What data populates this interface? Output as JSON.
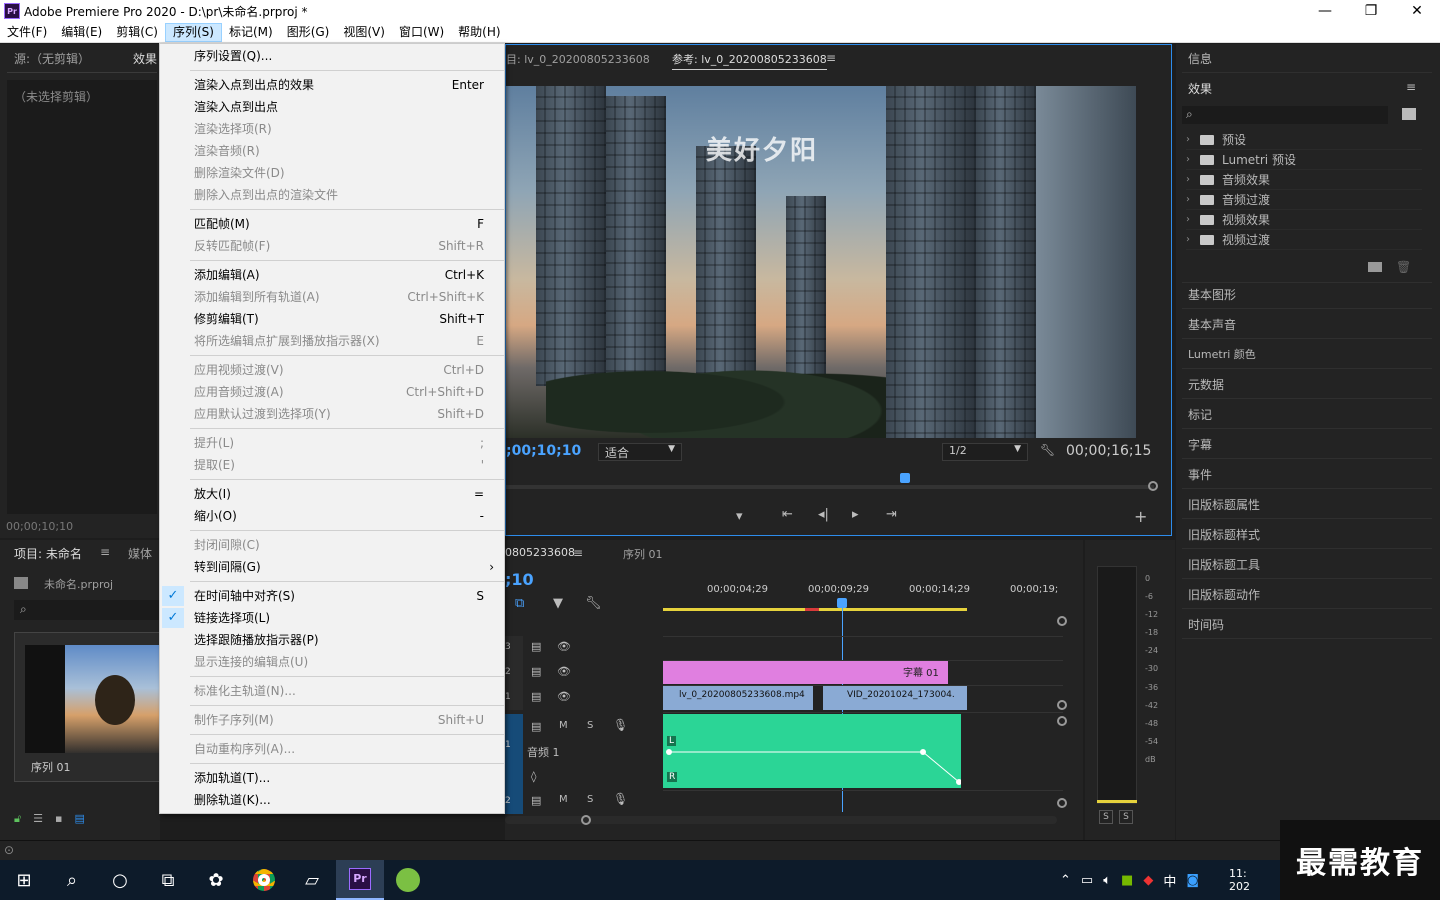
{
  "window": {
    "title": "Adobe Premiere Pro 2020 - D:\\pr\\未命名.prproj *",
    "app_icon": "Pr"
  },
  "menubar": [
    "文件(F)",
    "编辑(E)",
    "剪辑(C)",
    "序列(S)",
    "标记(M)",
    "图形(G)",
    "视图(V)",
    "窗口(W)",
    "帮助(H)"
  ],
  "source": {
    "tab_source": "源:（无剪辑）",
    "tab_effects": "效果",
    "no_clip": "（未选择剪辑）",
    "timecode": "00;00;10;10"
  },
  "project": {
    "tab_project": "项目: 未命名",
    "tab_media": "媒体",
    "file": "未命名.prproj",
    "thumb_label": "序列 01"
  },
  "program": {
    "tab_prev": "目: lv_0_20200805233608",
    "tab_ref": "参考: lv_0_20200805233608",
    "caption": "美好夕阳",
    "timecode_left": ";00;10;10",
    "fit": "适合",
    "resolution": "1/2",
    "timecode_right": "00;00;16;15"
  },
  "right_panel": {
    "info": "信息",
    "effects": "效果",
    "fx_items": [
      "预设",
      "Lumetri 预设",
      "音频效果",
      "音频过渡",
      "视频效果",
      "视频过渡"
    ],
    "sections": [
      "基本图形",
      "基本声音",
      "Lumetri 颜色",
      "元数据",
      "标记",
      "字幕",
      "事件",
      "旧版标题属性",
      "旧版标题样式",
      "旧版标题工具",
      "旧版标题动作",
      "时间码"
    ]
  },
  "timeline": {
    "tab_seq": "0805233608",
    "tab_seq2": "序列 01",
    "timecode": ";10",
    "ruler": [
      "00;00;04;29",
      "00;00;09;29",
      "00;00;14;29",
      "00;00;19;"
    ],
    "title_clip": "字幕 01",
    "clip1": "lv_0_20200805233608.mp4",
    "clip2": "VID_20201024_173004.",
    "audio_track": "音频 1",
    "track_labels": [
      "3",
      "2",
      "1",
      "1",
      "2"
    ],
    "btn_m": "M",
    "btn_s": "S",
    "ch_l": "L",
    "ch_r": "R"
  },
  "meter": {
    "scale": [
      "0",
      "-6",
      "-12",
      "-18",
      "-24",
      "-30",
      "-36",
      "-42",
      "-48",
      "-54",
      "dB"
    ],
    "solo": "S"
  },
  "sequence_menu": {
    "items": [
      {
        "label": "序列设置(Q)...",
        "shortcut": "",
        "disabled": false
      },
      {
        "label": "渲染入点到出点的效果",
        "shortcut": "Enter",
        "disabled": false
      },
      {
        "label": "渲染入点到出点",
        "shortcut": "",
        "disabled": false
      },
      {
        "label": "渲染选择项(R)",
        "shortcut": "",
        "disabled": true
      },
      {
        "label": "渲染音频(R)",
        "shortcut": "",
        "disabled": true
      },
      {
        "label": "删除渲染文件(D)",
        "shortcut": "",
        "disabled": true
      },
      {
        "label": "删除入点到出点的渲染文件",
        "shortcut": "",
        "disabled": true
      },
      {
        "label": "匹配帧(M)",
        "shortcut": "F",
        "disabled": false
      },
      {
        "label": "反转匹配帧(F)",
        "shortcut": "Shift+R",
        "disabled": true
      },
      {
        "label": "添加编辑(A)",
        "shortcut": "Ctrl+K",
        "disabled": false
      },
      {
        "label": "添加编辑到所有轨道(A)",
        "shortcut": "Ctrl+Shift+K",
        "disabled": true
      },
      {
        "label": "修剪编辑(T)",
        "shortcut": "Shift+T",
        "disabled": false
      },
      {
        "label": "将所选编辑点扩展到播放指示器(X)",
        "shortcut": "E",
        "disabled": true
      },
      {
        "label": "应用视频过渡(V)",
        "shortcut": "Ctrl+D",
        "disabled": true
      },
      {
        "label": "应用音频过渡(A)",
        "shortcut": "Ctrl+Shift+D",
        "disabled": true
      },
      {
        "label": "应用默认过渡到选择项(Y)",
        "shortcut": "Shift+D",
        "disabled": true
      },
      {
        "label": "提升(L)",
        "shortcut": ";",
        "disabled": true
      },
      {
        "label": "提取(E)",
        "shortcut": "'",
        "disabled": true
      },
      {
        "label": "放大(I)",
        "shortcut": "=",
        "disabled": false
      },
      {
        "label": "缩小(O)",
        "shortcut": "-",
        "disabled": false
      },
      {
        "label": "封闭间隙(C)",
        "shortcut": "",
        "disabled": true
      },
      {
        "label": "转到间隔(G)",
        "shortcut": "",
        "disabled": false
      },
      {
        "label": "在时间轴中对齐(S)",
        "shortcut": "S",
        "disabled": false
      },
      {
        "label": "链接选择项(L)",
        "shortcut": "",
        "disabled": false
      },
      {
        "label": "选择跟随播放指示器(P)",
        "shortcut": "",
        "disabled": false
      },
      {
        "label": "显示连接的编辑点(U)",
        "shortcut": "",
        "disabled": true
      },
      {
        "label": "标准化主轨道(N)...",
        "shortcut": "",
        "disabled": true
      },
      {
        "label": "制作子序列(M)",
        "shortcut": "Shift+U",
        "disabled": true
      },
      {
        "label": "自动重构序列(A)...",
        "shortcut": "",
        "disabled": true
      },
      {
        "label": "添加轨道(T)...",
        "shortcut": "",
        "disabled": false
      },
      {
        "label": "删除轨道(K)...",
        "shortcut": "",
        "disabled": false
      }
    ]
  },
  "taskbar": {
    "clock_line1": "11:",
    "clock_line2": "202",
    "ime": "中",
    "watermark": "最需教育"
  },
  "colors": {
    "accent": "#2d8ceb",
    "title_clip": "#e07fe0",
    "video_clip": "#8aaad4",
    "audio_clip": "#2bd596",
    "playhead": "#4aa3ff"
  }
}
